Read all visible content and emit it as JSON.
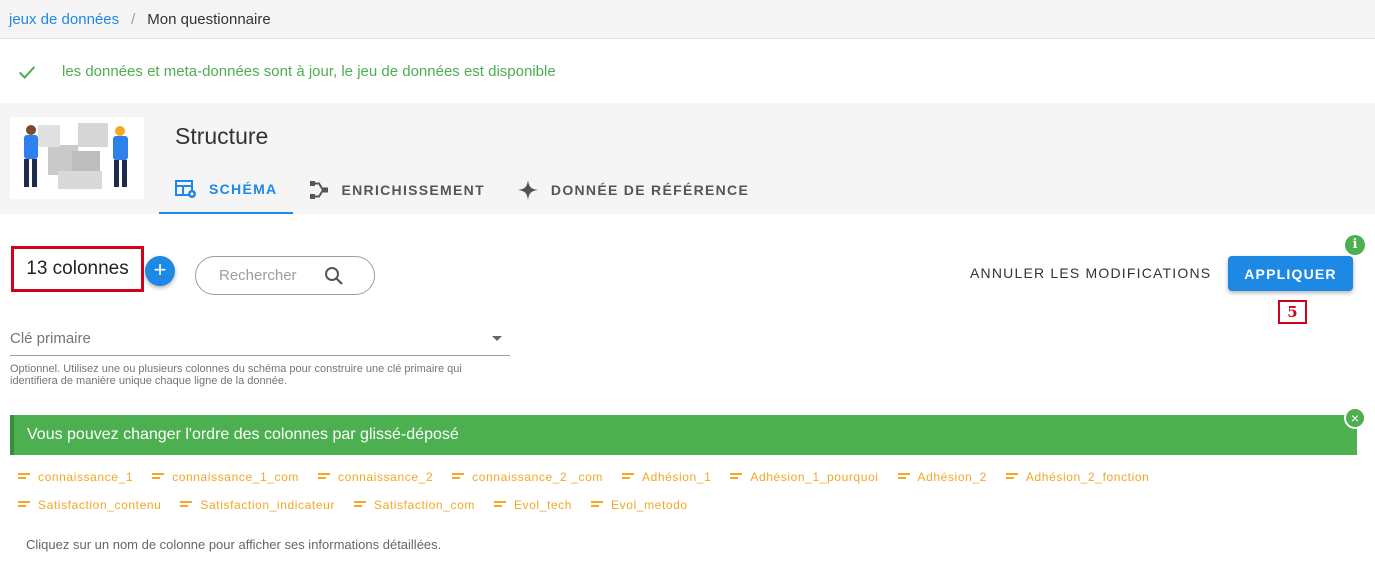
{
  "breadcrumb": {
    "parent": "jeux de données",
    "separator": "/",
    "current": "Mon questionnaire"
  },
  "status": {
    "icon": "check-icon",
    "text": "les données et meta-données sont à jour, le jeu de données est disponible",
    "color": "#4caf50"
  },
  "header": {
    "title": "Structure",
    "tabs": [
      {
        "label": "SCHÉMA",
        "icon": "table-settings-icon",
        "active": true
      },
      {
        "label": "ENRICHISSEMENT",
        "icon": "merge-icon",
        "active": false
      },
      {
        "label": "DONNÉE DE RÉFÉRENCE",
        "icon": "sparkle-icon",
        "active": false
      }
    ]
  },
  "toolbar": {
    "column_count": "13 colonnes",
    "add_label": "+",
    "search_placeholder": "Rechercher",
    "cancel_label": "ANNULER LES MODIFICATIONS",
    "apply_label": "APPLIQUER",
    "info_label": "i",
    "step_badge": "5"
  },
  "primary_key": {
    "placeholder": "Clé primaire",
    "hint": "Optionnel. Utilisez une ou plusieurs colonnes du schéma pour construire une clé primaire qui identifiera de manière unique chaque ligne de la donnée."
  },
  "banner": {
    "text": "Vous pouvez changer l'ordre des colonnes par glissé-déposé",
    "close_label": "×"
  },
  "columns": {
    "row1": [
      "connaissance_1",
      "connaissance_1_com",
      "connaissance_2",
      "connaissance_2 _com",
      "Adhésion_1",
      "Adhésion_1_pourquoi",
      "Adhésion_2",
      "Adhésion_2_fonction"
    ],
    "row2": [
      "Satisfaction_contenu",
      "Satisfaction_indicateur",
      "Satisfaction_com",
      "Evol_tech",
      "Evol_metodo"
    ]
  },
  "footer_hint": "Cliquez sur un nom de colonne pour afficher ses informations détaillées.",
  "colors": {
    "accent": "#1e88e5",
    "success": "#4caf50",
    "chip": "#f5a623",
    "highlight": "#d0021b"
  }
}
